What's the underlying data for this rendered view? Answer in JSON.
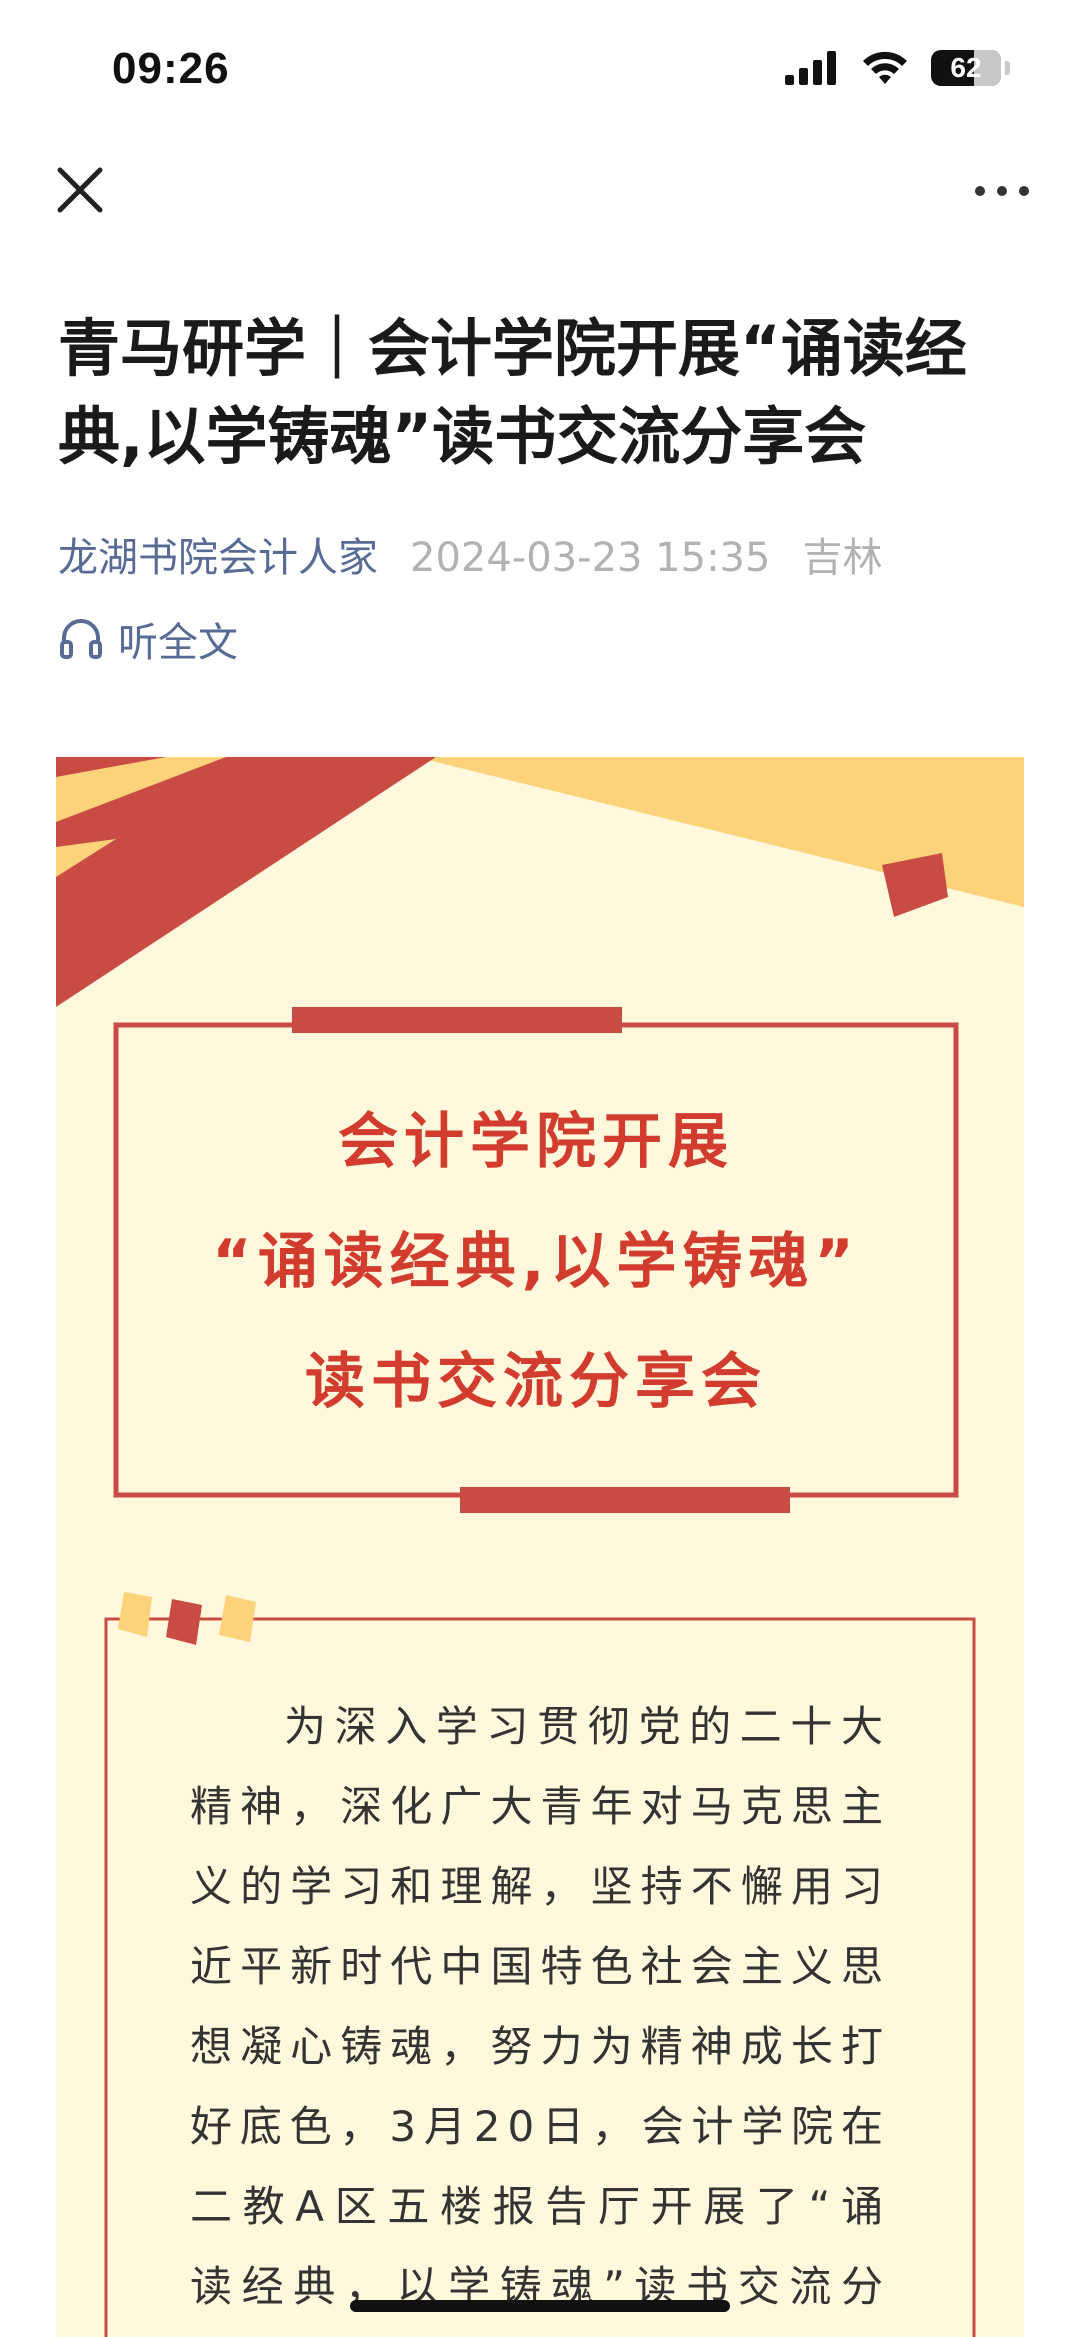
{
  "status_bar": {
    "time": "09:26",
    "battery": "62",
    "icons": [
      "signal-icon",
      "wifi-icon",
      "battery-icon"
    ]
  },
  "nav": {
    "close_icon": "close-icon",
    "more_icon": "more-icon"
  },
  "article": {
    "title": "青马研学｜会计学院开展“诵读经典,以学铸魂”读书交流分享会",
    "account": "龙湖书院会计人家",
    "date": "2024-03-23 15:35",
    "location": "吉林",
    "listen_label": "听全文"
  },
  "poster": {
    "headline": [
      "会计学院开展",
      "“诵读经典,以学铸魂”",
      "读书交流分享会"
    ],
    "body": "为深入学习贯彻党的二十大精神，深化广大青年对马克思主义的学习和理解，坚持不懈用习近平新时代中国特色社会主义思想凝心铸魂，努力为精神成长打好底色，3月20日，会计学院在二教A区五楼报告厅开展了“诵读经典，以学铸魂”读书交流分享"
  },
  "colors": {
    "link": "#576b95",
    "meta_gray": "#b2b2b2",
    "poster_red": "#c84b44",
    "poster_yellow": "#fcd27a",
    "poster_bg": "#fff8dc",
    "headline_red": "#d13c2e"
  }
}
